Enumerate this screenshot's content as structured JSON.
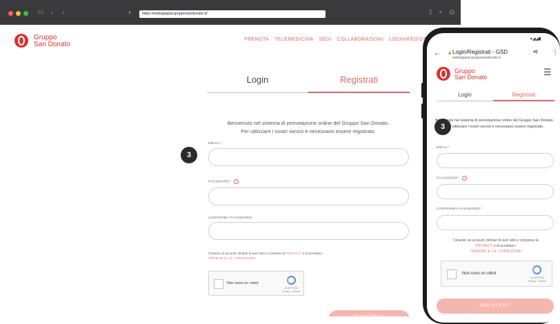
{
  "browser": {
    "url": "https://webappgsd.grupposandonato.it/"
  },
  "site": {
    "brand_line1": "Gruppo",
    "brand_line2": "San Donato",
    "nav": [
      "PRENOTA",
      "TELEMEDICINA",
      "SEDI",
      "COLLABORAZIONI",
      "LOGIN/REGISTRATI"
    ],
    "tabs": {
      "login": "Login",
      "register": "Registrati"
    },
    "welcome_line1": "Benvenuto nel sistema di prenotazione online del Gruppo San Donato.",
    "welcome_line2": "Per utilizzare i nostri servizi è necessario essere registrato.",
    "email_label": "EMAIL*",
    "password_label": "PASSWORD*",
    "confirm_label": "CONFERMA PASSWORD*",
    "info_symbol": "i",
    "terms_prefix": "Creando un account, dichiari di aver letto e compreso la",
    "privacy_link": "PRIVACY",
    "terms_mid": "e di accettare i",
    "terms_link": "TERMINI E LE CONDIZIONI",
    "recaptcha_label": "Non sono un robot",
    "recaptcha_brand": "reCAPTCHA",
    "recaptcha_links": "Privacy - Termini",
    "submit": "REGISTRATI",
    "step_badge": "3"
  },
  "phone": {
    "page_title": "Login/Registrati - GSD",
    "url": "webappgsd.grupposandonato.it",
    "welcome": "Benvenuto nel sistema di prenotazione online del Gruppo San Donato. Per utilizzare i nostri servizi è necessario essere registrato.",
    "step_badge": "3"
  },
  "colors": {
    "accent": "#e0665d",
    "brand_red": "#d8322c",
    "button_disabled": "#f6b6b0",
    "badge": "#2b2b2b"
  }
}
